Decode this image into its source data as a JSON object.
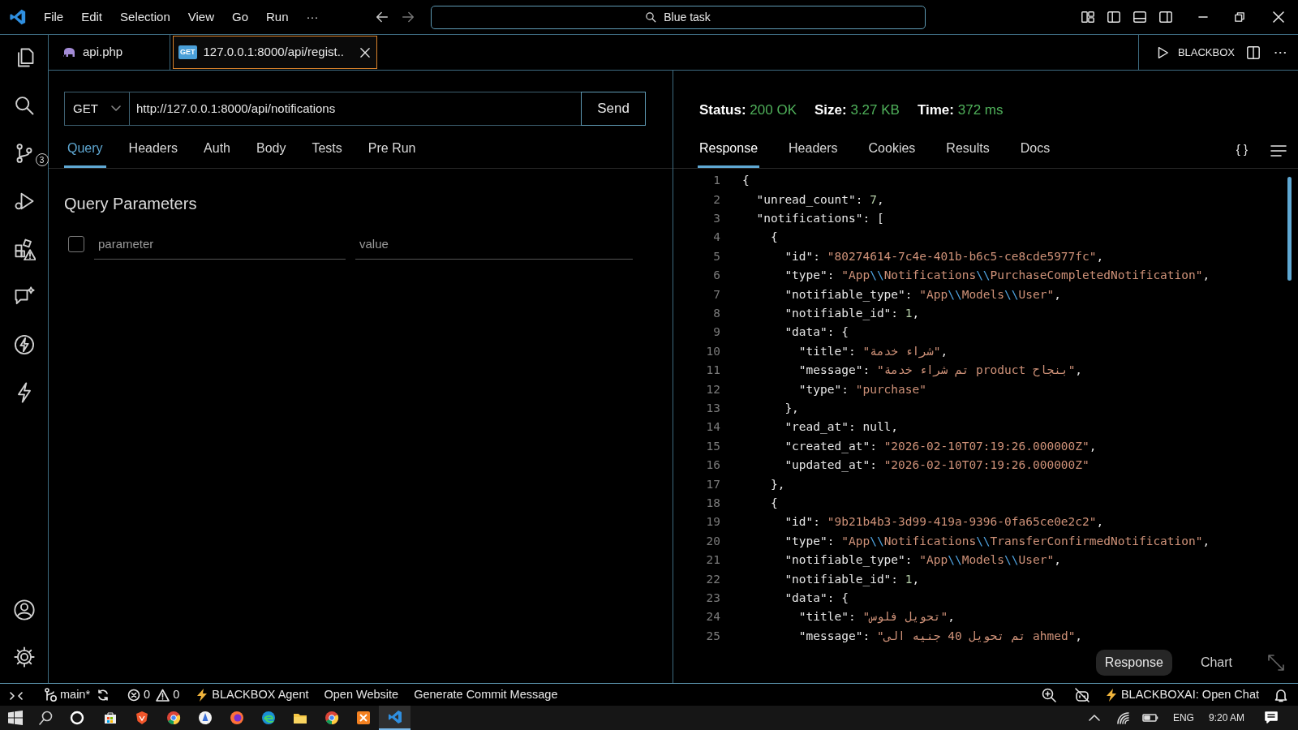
{
  "title_bar": {
    "menu": [
      "File",
      "Edit",
      "Selection",
      "View",
      "Go",
      "Run",
      "···"
    ],
    "search": "Blue task"
  },
  "activity_bar": {
    "source_control_badge": "3"
  },
  "editor_tabs": [
    {
      "label": "api.php",
      "kind": "php",
      "selected": false
    },
    {
      "label": "127.0.0.1:8000/api/regist..",
      "kind": "request",
      "badge": "GET",
      "selected": true
    }
  ],
  "editor_actions": {
    "label": "BLACKBOX"
  },
  "request": {
    "method": "GET",
    "url": "http://127.0.0.1:8000/api/notifications",
    "send": "Send",
    "tabs": [
      {
        "label": "Query",
        "selected": true
      },
      {
        "label": "Headers",
        "selected": false
      },
      {
        "label": "Auth",
        "selected": false
      },
      {
        "label": "Body",
        "selected": false
      },
      {
        "label": "Tests",
        "selected": false
      },
      {
        "label": "Pre Run",
        "selected": false
      }
    ],
    "section_title": "Query Parameters",
    "param_row": {
      "checked": false,
      "parameter_placeholder": "parameter",
      "value_placeholder": "value"
    }
  },
  "response": {
    "stats": [
      {
        "label": "Status:",
        "value": "200 OK"
      },
      {
        "label": "Size:",
        "value": "3.27 KB"
      },
      {
        "label": "Time:",
        "value": "372 ms"
      }
    ],
    "tabs": [
      {
        "label": "Response",
        "selected": true
      },
      {
        "label": "Headers",
        "selected": false
      },
      {
        "label": "Cookies",
        "selected": false
      },
      {
        "label": "Results",
        "selected": false
      },
      {
        "label": "Docs",
        "selected": false
      }
    ],
    "format_button": "{ }",
    "lines": [
      {
        "n": "1",
        "text": "{"
      },
      {
        "n": "2",
        "text": "  \"unread_count\": 7,"
      },
      {
        "n": "3",
        "text": "  \"notifications\": ["
      },
      {
        "n": "4",
        "text": "    {"
      },
      {
        "n": "5",
        "text": "      \"id\": \"80274614-7c4e-401b-b6c5-ce8cde5977fc\","
      },
      {
        "n": "6",
        "text": "      \"type\": \"App\\\\Notifications\\\\PurchaseCompletedNotification\","
      },
      {
        "n": "7",
        "text": "      \"notifiable_type\": \"App\\\\Models\\\\User\","
      },
      {
        "n": "8",
        "text": "      \"notifiable_id\": 1,"
      },
      {
        "n": "9",
        "text": "      \"data\": {"
      },
      {
        "n": "10",
        "text": "        \"title\": \"شراء خدمة\","
      },
      {
        "n": "11",
        "text": "        \"message\": \"تم شراء خدمة product بنجاح\","
      },
      {
        "n": "12",
        "text": "        \"type\": \"purchase\""
      },
      {
        "n": "13",
        "text": "      },"
      },
      {
        "n": "14",
        "text": "      \"read_at\": null,"
      },
      {
        "n": "15",
        "text": "      \"created_at\": \"2026-02-10T07:19:26.000000Z\","
      },
      {
        "n": "16",
        "text": "      \"updated_at\": \"2026-02-10T07:19:26.000000Z\""
      },
      {
        "n": "17",
        "text": "    },"
      },
      {
        "n": "18",
        "text": "    {"
      },
      {
        "n": "19",
        "text": "      \"id\": \"9b21b4b3-3d99-419a-9396-0fa65ce0e2c2\","
      },
      {
        "n": "20",
        "text": "      \"type\": \"App\\\\Notifications\\\\TransferConfirmedNotification\","
      },
      {
        "n": "21",
        "text": "      \"notifiable_type\": \"App\\\\Models\\\\User\","
      },
      {
        "n": "22",
        "text": "      \"notifiable_id\": 1,"
      },
      {
        "n": "23",
        "text": "      \"data\": {"
      },
      {
        "n": "24",
        "text": "        \"title\": \"تحويل فلوس\","
      },
      {
        "n": "25",
        "text": "        \"message\": \"تم تحويل 40 جنيه الى ahmed\","
      }
    ],
    "view_toggle": [
      {
        "label": "Response",
        "selected": true
      },
      {
        "label": "Chart",
        "selected": false
      }
    ]
  },
  "status_bar": {
    "branch": "main*",
    "errors": "0",
    "warnings": "0",
    "items": [
      "BLACKBOX Agent",
      "Open Website",
      "Generate Commit Message"
    ],
    "chat": "BLACKBOXAI: Open Chat"
  },
  "taskbar": {
    "language": "ENG",
    "time": "9:20 AM"
  }
}
